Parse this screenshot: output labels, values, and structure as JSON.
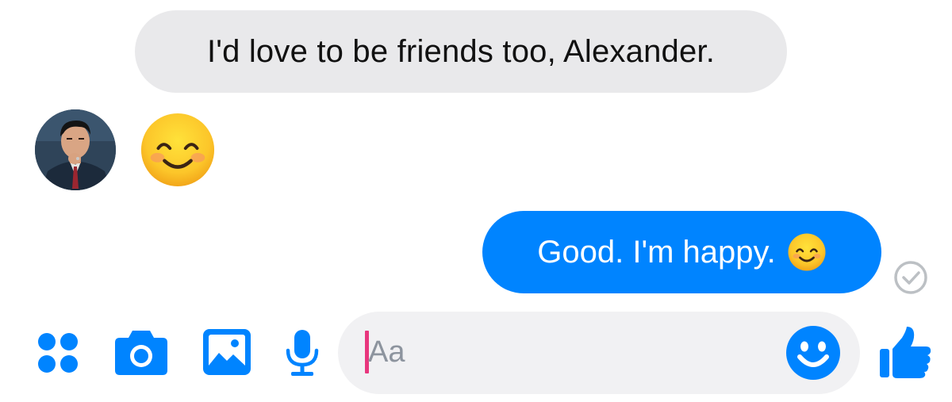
{
  "conversation": {
    "messages": [
      {
        "direction": "incoming",
        "text": "I'd love to be friends too, Alexander."
      },
      {
        "direction": "incoming",
        "content": "smiling-face-with-smiling-eyes-emoji"
      },
      {
        "direction": "outgoing",
        "text": "Good. I'm happy.",
        "emoji": "smiling-face-emoji",
        "status": "sent-check"
      }
    ]
  },
  "composer": {
    "placeholder": "Aa",
    "value": ""
  },
  "toolbar": {
    "icons": [
      "more-apps-icon",
      "camera-icon",
      "gallery-icon",
      "microphone-icon",
      "emoji-icon",
      "thumbs-up-icon"
    ]
  },
  "colors": {
    "accent": "#0084ff",
    "incoming_bubble": "#e9e9eb",
    "composer_bg": "#f1f1f3",
    "caret": "#e8367d",
    "receipt": "#bcc0c4"
  }
}
